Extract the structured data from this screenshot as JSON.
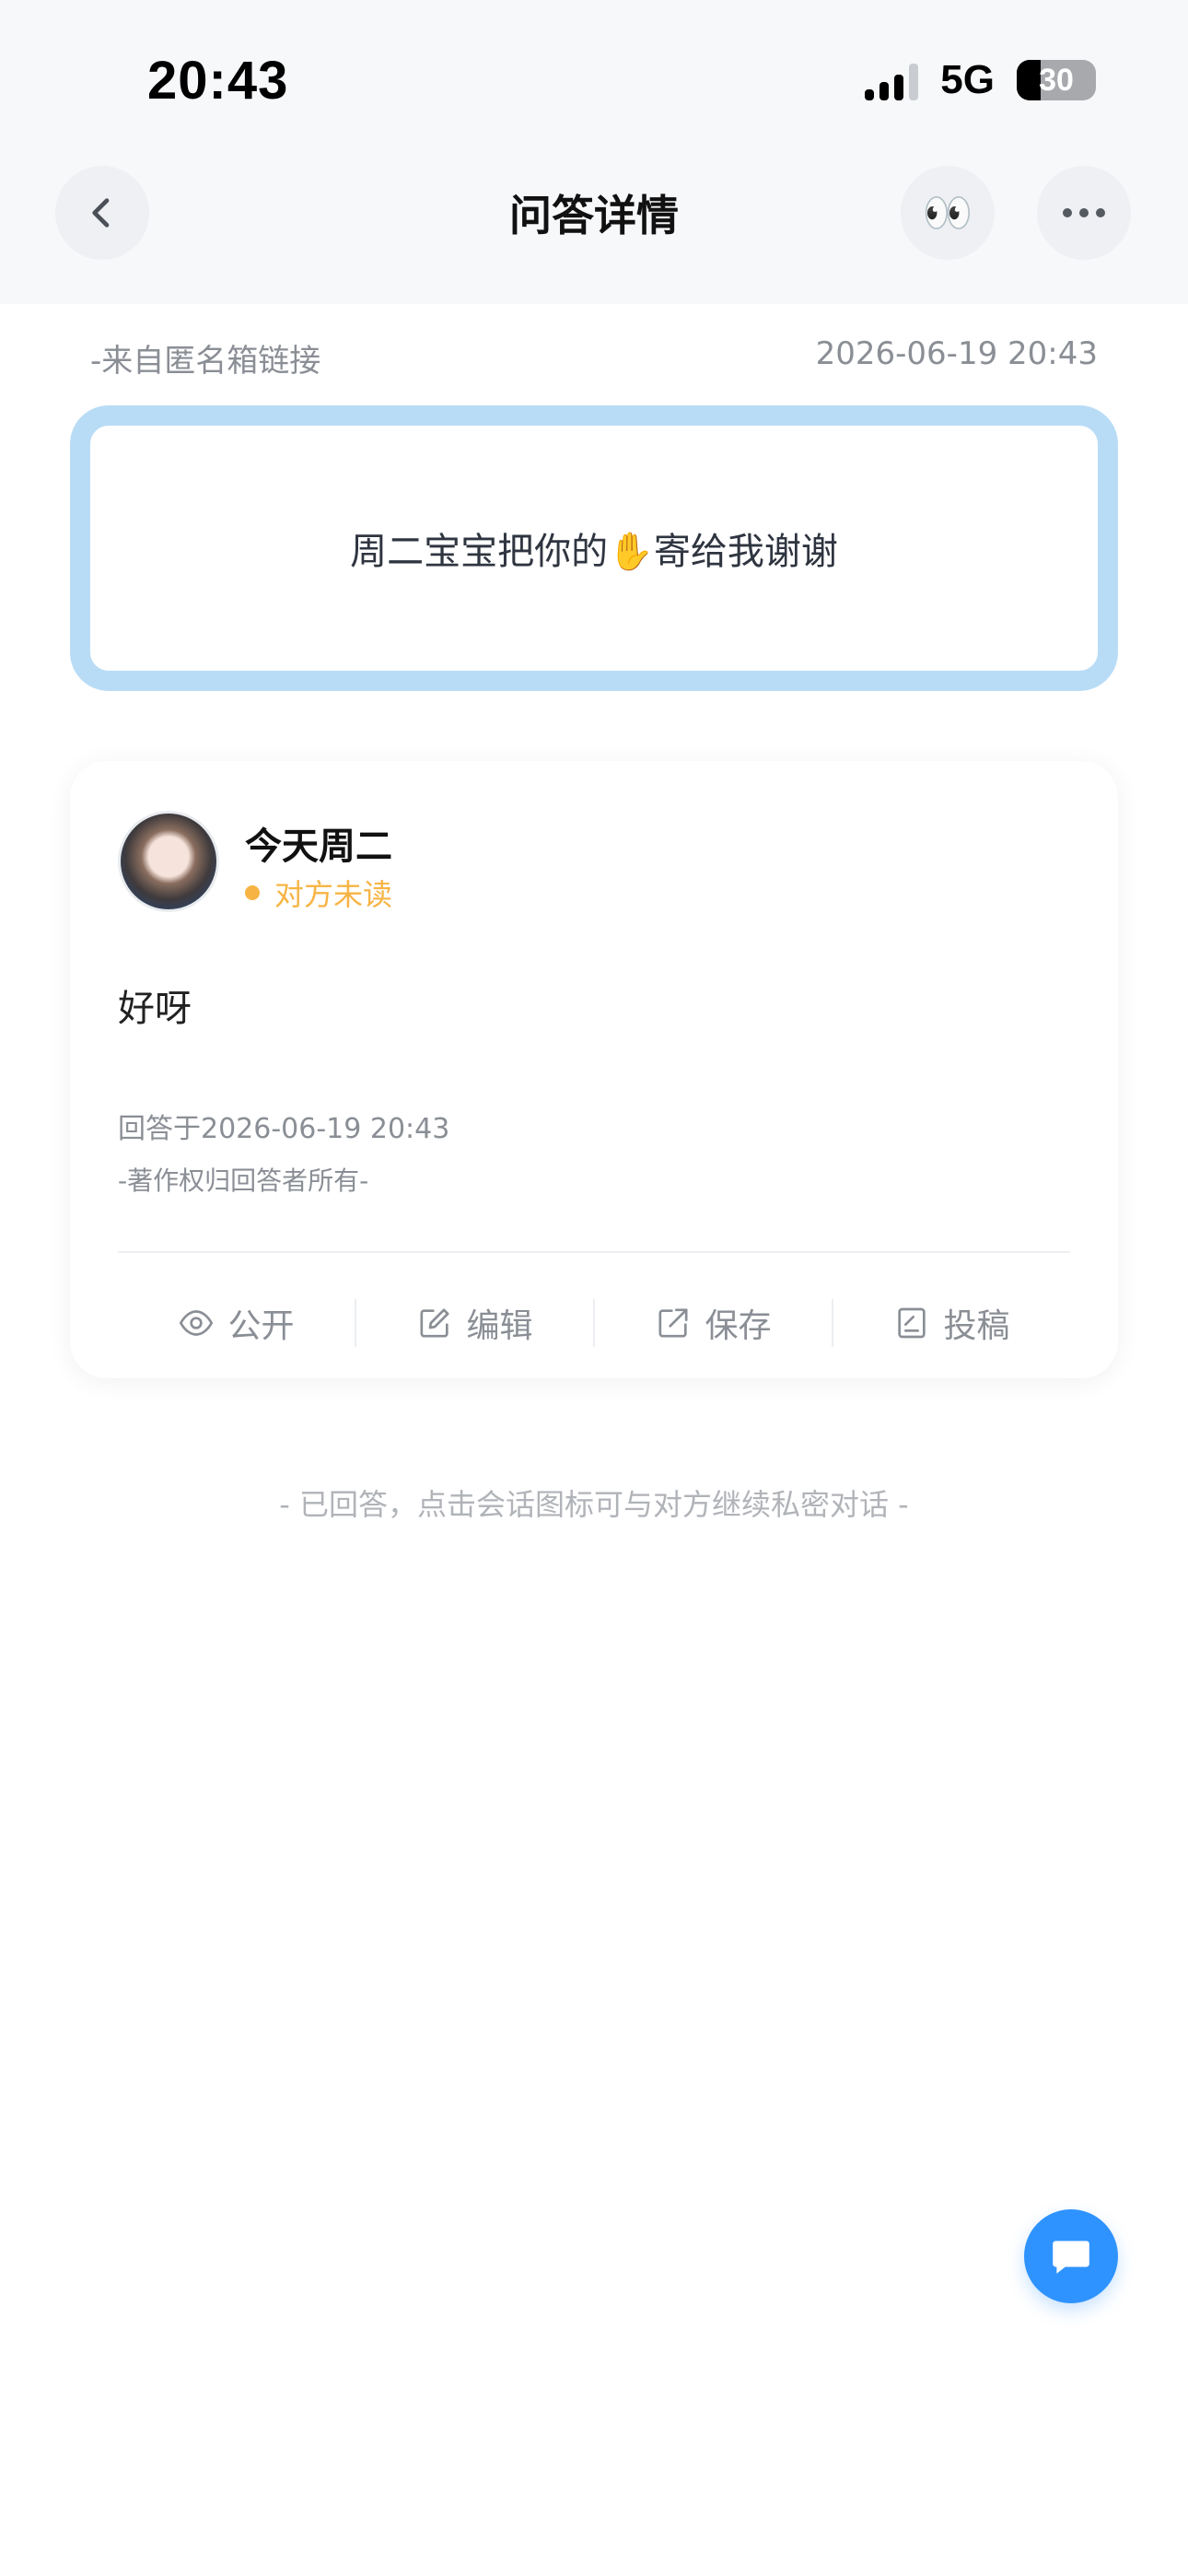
{
  "status_bar": {
    "time": "20:43",
    "network": "5G",
    "battery_percent": 30,
    "battery_text": "30",
    "signal_bars": 3
  },
  "nav": {
    "title": "问答详情",
    "back_icon": "chevron-left-icon",
    "eyes_icon": "👀",
    "more_icon": "more-icon"
  },
  "meta": {
    "source": "-来自匿名箱链接",
    "time": "2026-06-19 20:43"
  },
  "question": {
    "text": "周二宝宝把你的✋寄给我谢谢"
  },
  "answer": {
    "user_name": "今天周二",
    "read_status": "对方未读",
    "text": "好呀",
    "date": "回答于2026-06-19 20:43",
    "copyright": "-著作权归回答者所有-",
    "actions": [
      {
        "icon": "eye-icon",
        "label": "公开"
      },
      {
        "icon": "edit-icon",
        "label": "编辑"
      },
      {
        "icon": "share-icon",
        "label": "保存"
      },
      {
        "icon": "document-icon",
        "label": "投稿"
      }
    ]
  },
  "footer_hint": "- 已回答，点击会话图标可与对方继续私密对话 -",
  "colors": {
    "accent": "#2f93ff",
    "question_border": "#b9dcf6",
    "unread": "#f7b445",
    "muted_text": "#8a8e95"
  }
}
